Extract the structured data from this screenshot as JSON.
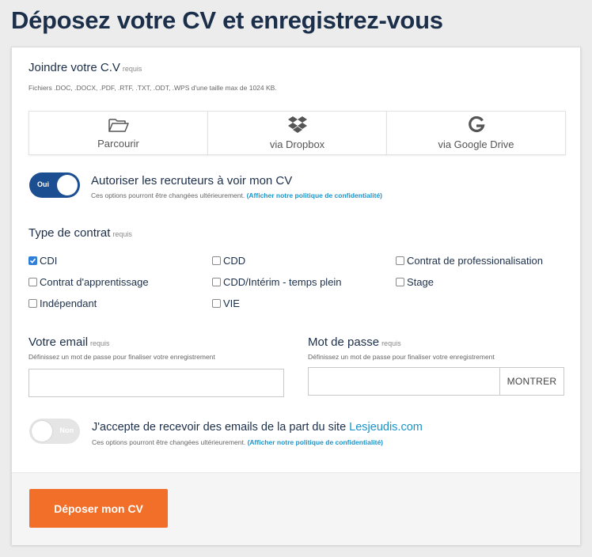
{
  "page": {
    "title": "Déposez votre CV et enregistrez-vous"
  },
  "cv": {
    "label": "Joindre votre C.V",
    "required": "requis",
    "hint": "Fichiers .DOC, .DOCX, .PDF, .RTF, .TXT, .ODT, .WPS d'une taille max de 1024 KB.",
    "sources": [
      {
        "label": "Parcourir",
        "icon": "folder-icon"
      },
      {
        "label": "via Dropbox",
        "icon": "dropbox-icon"
      },
      {
        "label": "via Google Drive",
        "icon": "google-icon"
      }
    ]
  },
  "visibility": {
    "toggle_text": "Oui",
    "toggle_on": true,
    "label": "Autoriser les recruteurs à voir mon CV",
    "hint": "Ces options pourront être changées ultérieurement.",
    "policy_link": "(Afficher notre politique de confidentialité)"
  },
  "contract": {
    "label": "Type de contrat",
    "required": "requis",
    "options": [
      {
        "label": "CDI",
        "checked": true
      },
      {
        "label": "CDD",
        "checked": false
      },
      {
        "label": "Contrat de professionalisation",
        "checked": false
      },
      {
        "label": "Contrat d'apprentissage",
        "checked": false
      },
      {
        "label": "CDD/Intérim - temps plein",
        "checked": false
      },
      {
        "label": "Stage",
        "checked": false
      },
      {
        "label": "Indépendant",
        "checked": false
      },
      {
        "label": "VIE",
        "checked": false
      }
    ]
  },
  "email": {
    "label": "Votre email",
    "required": "requis",
    "hint": "Définissez un mot de passe pour finaliser votre enregistrement",
    "value": ""
  },
  "password": {
    "label": "Mot de passe",
    "required": "requis",
    "hint": "Définissez un mot de passe pour finaliser votre enregistrement",
    "value": "",
    "show_label": "MONTRER"
  },
  "newsletter": {
    "toggle_text": "Non",
    "toggle_on": false,
    "label": "J'accepte de recevoir des emails de la part du site",
    "site": "Lesjeudis.com",
    "hint": "Ces options pourront être changées ultérieurement.",
    "policy_link": "(Afficher notre politique de confidentialité)"
  },
  "submit": {
    "label": "Déposer mon CV"
  },
  "colors": {
    "navy": "#1c2f4a",
    "toggle_on": "#1c4f91",
    "link": "#1a94c9",
    "accent": "#f26f2a"
  }
}
